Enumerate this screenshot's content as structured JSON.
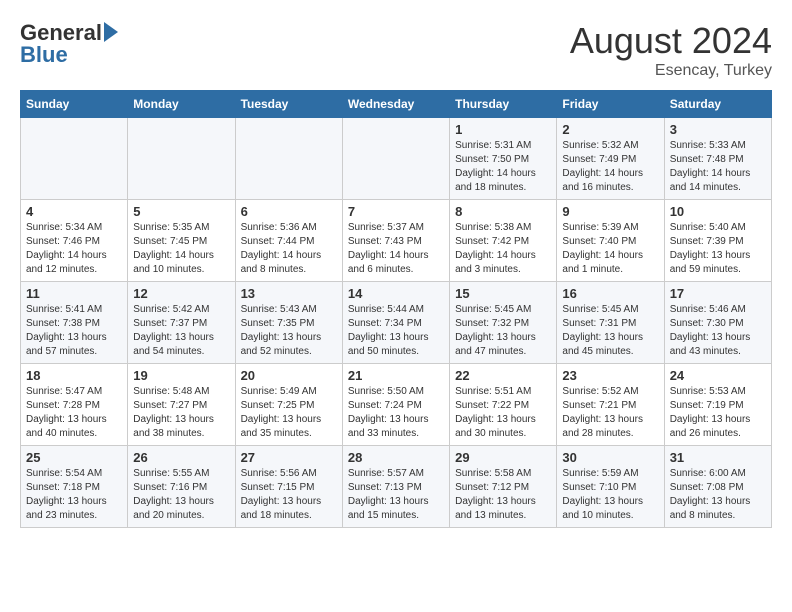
{
  "header": {
    "logo_general": "General",
    "logo_blue": "Blue",
    "month_year": "August 2024",
    "location": "Esencay, Turkey"
  },
  "days_of_week": [
    "Sunday",
    "Monday",
    "Tuesday",
    "Wednesday",
    "Thursday",
    "Friday",
    "Saturday"
  ],
  "weeks": [
    [
      {
        "day": "",
        "info": ""
      },
      {
        "day": "",
        "info": ""
      },
      {
        "day": "",
        "info": ""
      },
      {
        "day": "",
        "info": ""
      },
      {
        "day": "1",
        "info": "Sunrise: 5:31 AM\nSunset: 7:50 PM\nDaylight: 14 hours\nand 18 minutes."
      },
      {
        "day": "2",
        "info": "Sunrise: 5:32 AM\nSunset: 7:49 PM\nDaylight: 14 hours\nand 16 minutes."
      },
      {
        "day": "3",
        "info": "Sunrise: 5:33 AM\nSunset: 7:48 PM\nDaylight: 14 hours\nand 14 minutes."
      }
    ],
    [
      {
        "day": "4",
        "info": "Sunrise: 5:34 AM\nSunset: 7:46 PM\nDaylight: 14 hours\nand 12 minutes."
      },
      {
        "day": "5",
        "info": "Sunrise: 5:35 AM\nSunset: 7:45 PM\nDaylight: 14 hours\nand 10 minutes."
      },
      {
        "day": "6",
        "info": "Sunrise: 5:36 AM\nSunset: 7:44 PM\nDaylight: 14 hours\nand 8 minutes."
      },
      {
        "day": "7",
        "info": "Sunrise: 5:37 AM\nSunset: 7:43 PM\nDaylight: 14 hours\nand 6 minutes."
      },
      {
        "day": "8",
        "info": "Sunrise: 5:38 AM\nSunset: 7:42 PM\nDaylight: 14 hours\nand 3 minutes."
      },
      {
        "day": "9",
        "info": "Sunrise: 5:39 AM\nSunset: 7:40 PM\nDaylight: 14 hours\nand 1 minute."
      },
      {
        "day": "10",
        "info": "Sunrise: 5:40 AM\nSunset: 7:39 PM\nDaylight: 13 hours\nand 59 minutes."
      }
    ],
    [
      {
        "day": "11",
        "info": "Sunrise: 5:41 AM\nSunset: 7:38 PM\nDaylight: 13 hours\nand 57 minutes."
      },
      {
        "day": "12",
        "info": "Sunrise: 5:42 AM\nSunset: 7:37 PM\nDaylight: 13 hours\nand 54 minutes."
      },
      {
        "day": "13",
        "info": "Sunrise: 5:43 AM\nSunset: 7:35 PM\nDaylight: 13 hours\nand 52 minutes."
      },
      {
        "day": "14",
        "info": "Sunrise: 5:44 AM\nSunset: 7:34 PM\nDaylight: 13 hours\nand 50 minutes."
      },
      {
        "day": "15",
        "info": "Sunrise: 5:45 AM\nSunset: 7:32 PM\nDaylight: 13 hours\nand 47 minutes."
      },
      {
        "day": "16",
        "info": "Sunrise: 5:45 AM\nSunset: 7:31 PM\nDaylight: 13 hours\nand 45 minutes."
      },
      {
        "day": "17",
        "info": "Sunrise: 5:46 AM\nSunset: 7:30 PM\nDaylight: 13 hours\nand 43 minutes."
      }
    ],
    [
      {
        "day": "18",
        "info": "Sunrise: 5:47 AM\nSunset: 7:28 PM\nDaylight: 13 hours\nand 40 minutes."
      },
      {
        "day": "19",
        "info": "Sunrise: 5:48 AM\nSunset: 7:27 PM\nDaylight: 13 hours\nand 38 minutes."
      },
      {
        "day": "20",
        "info": "Sunrise: 5:49 AM\nSunset: 7:25 PM\nDaylight: 13 hours\nand 35 minutes."
      },
      {
        "day": "21",
        "info": "Sunrise: 5:50 AM\nSunset: 7:24 PM\nDaylight: 13 hours\nand 33 minutes."
      },
      {
        "day": "22",
        "info": "Sunrise: 5:51 AM\nSunset: 7:22 PM\nDaylight: 13 hours\nand 30 minutes."
      },
      {
        "day": "23",
        "info": "Sunrise: 5:52 AM\nSunset: 7:21 PM\nDaylight: 13 hours\nand 28 minutes."
      },
      {
        "day": "24",
        "info": "Sunrise: 5:53 AM\nSunset: 7:19 PM\nDaylight: 13 hours\nand 26 minutes."
      }
    ],
    [
      {
        "day": "25",
        "info": "Sunrise: 5:54 AM\nSunset: 7:18 PM\nDaylight: 13 hours\nand 23 minutes."
      },
      {
        "day": "26",
        "info": "Sunrise: 5:55 AM\nSunset: 7:16 PM\nDaylight: 13 hours\nand 20 minutes."
      },
      {
        "day": "27",
        "info": "Sunrise: 5:56 AM\nSunset: 7:15 PM\nDaylight: 13 hours\nand 18 minutes."
      },
      {
        "day": "28",
        "info": "Sunrise: 5:57 AM\nSunset: 7:13 PM\nDaylight: 13 hours\nand 15 minutes."
      },
      {
        "day": "29",
        "info": "Sunrise: 5:58 AM\nSunset: 7:12 PM\nDaylight: 13 hours\nand 13 minutes."
      },
      {
        "day": "30",
        "info": "Sunrise: 5:59 AM\nSunset: 7:10 PM\nDaylight: 13 hours\nand 10 minutes."
      },
      {
        "day": "31",
        "info": "Sunrise: 6:00 AM\nSunset: 7:08 PM\nDaylight: 13 hours\nand 8 minutes."
      }
    ]
  ]
}
